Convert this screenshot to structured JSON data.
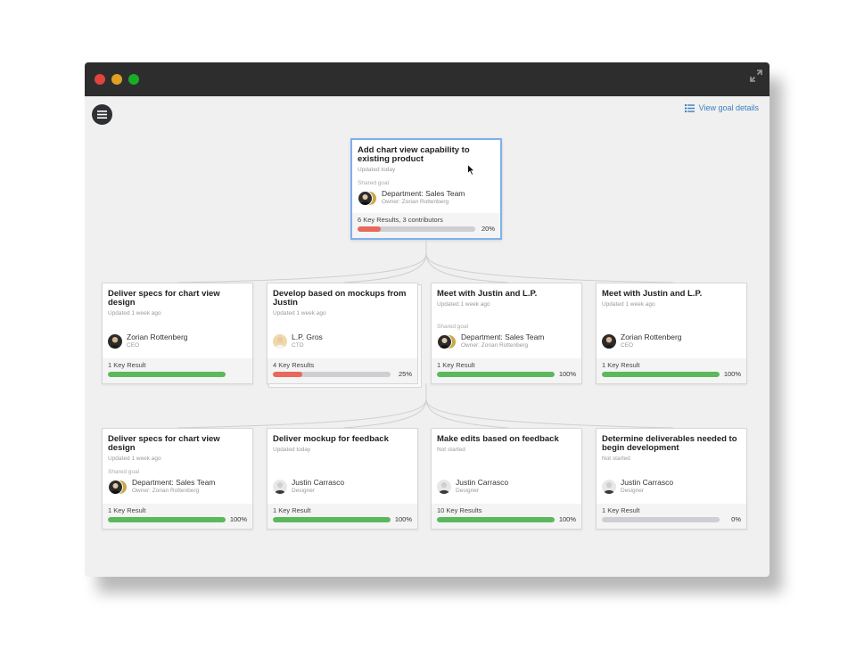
{
  "header": {
    "view_goal_details": "View goal details"
  },
  "root": {
    "title": "Add chart view capability to existing product",
    "updated": "Updated today",
    "shared": "Shared goal",
    "owner_name": "Department: Sales Team",
    "owner_sub": "Owner: Zorian Rottenberg",
    "key_results": "6 Key Results, 3 contributors",
    "progress": 20,
    "progress_label": "20%",
    "bar_color": "#e8685a"
  },
  "row1": [
    {
      "title": "Deliver specs for chart view design",
      "updated": "Updated 1 week ago",
      "shared": "",
      "owner_name": "Zorian Rottenberg",
      "owner_sub": "CEO",
      "avatar": "single",
      "key_results": "1 Key Result",
      "progress": 100,
      "progress_label": "",
      "bar_color": "#5cb85c"
    },
    {
      "title": "Develop based on mockups from Justin",
      "updated": "Updated 1 week ago",
      "shared": "",
      "owner_name": "L.P. Gros",
      "owner_sub": "CTO",
      "avatar": "single-light",
      "key_results": "4 Key Results",
      "progress": 25,
      "progress_label": "25%",
      "bar_color": "#e8685a"
    },
    {
      "title": "Meet with Justin and L.P.",
      "updated": "Updated 1 week ago",
      "shared": "Shared goal",
      "owner_name": "Department: Sales Team",
      "owner_sub": "Owner: Zorian Rottenberg",
      "avatar": "stack",
      "key_results": "1 Key Result",
      "progress": 100,
      "progress_label": "100%",
      "bar_color": "#5cb85c"
    },
    {
      "title": "Meet with Justin and L.P.",
      "updated": "Updated 1 week ago",
      "shared": "",
      "owner_name": "Zorian Rottenberg",
      "owner_sub": "CEO",
      "avatar": "single",
      "key_results": "1 Key Result",
      "progress": 100,
      "progress_label": "100%",
      "bar_color": "#5cb85c"
    }
  ],
  "row2": [
    {
      "title": "Deliver specs for chart view design",
      "updated": "Updated 1 week ago",
      "shared": "Shared goal",
      "owner_name": "Department: Sales Team",
      "owner_sub": "Owner: Zorian Rottenberg",
      "avatar": "stack",
      "key_results": "1 Key Result",
      "progress": 100,
      "progress_label": "100%",
      "bar_color": "#5cb85c"
    },
    {
      "title": "Deliver mockup for feedback",
      "updated": "Updated today",
      "shared": "",
      "owner_name": "Justin Carrasco",
      "owner_sub": "Designer",
      "avatar": "single-bw",
      "key_results": "1 Key Result",
      "progress": 100,
      "progress_label": "100%",
      "bar_color": "#5cb85c"
    },
    {
      "title": "Make edits based on feedback",
      "updated": "Not started",
      "shared": "",
      "owner_name": "Justin Carrasco",
      "owner_sub": "Designer",
      "avatar": "single-bw",
      "key_results": "10 Key Results",
      "progress": 100,
      "progress_label": "100%",
      "bar_color": "#5cb85c"
    },
    {
      "title": "Determine deliverables needed to begin development",
      "updated": "Not started",
      "shared": "",
      "owner_name": "Justin Carrasco",
      "owner_sub": "Designer",
      "avatar": "single-bw",
      "key_results": "1 Key Result",
      "progress": 0,
      "progress_label": "0%",
      "bar_color": "#5cb85c"
    }
  ]
}
